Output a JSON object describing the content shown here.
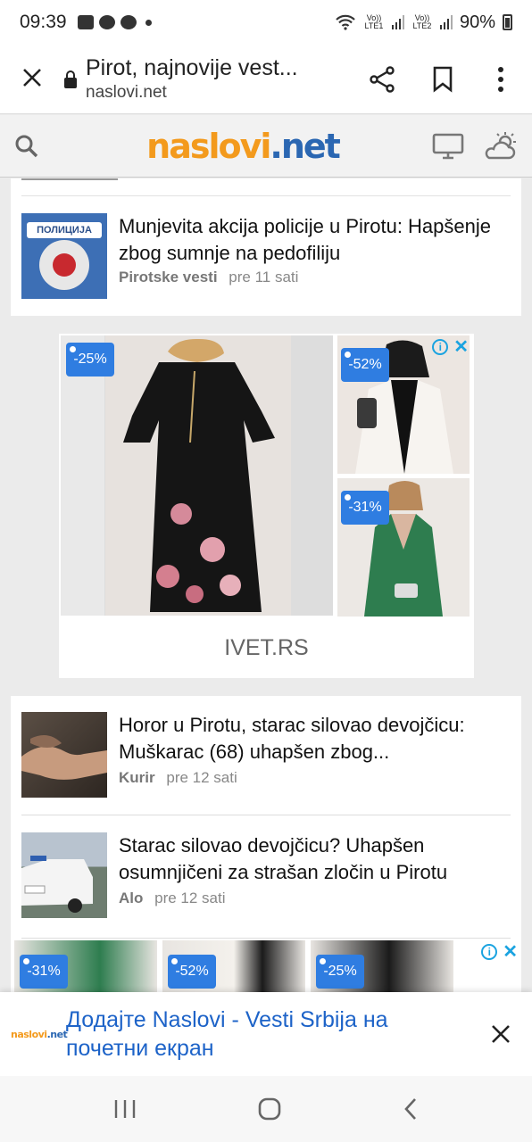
{
  "status_bar": {
    "time": "09:39",
    "lte1": "Vo)) LTE1",
    "lte2": "Vo)) LTE2",
    "battery": "90%"
  },
  "browser": {
    "page_title": "Pirot, najnovije vest...",
    "domain": "naslovi.net"
  },
  "site": {
    "logo_part1": "naslovi",
    "logo_part2": "net"
  },
  "articles": [
    {
      "title": "Munjevita akcija policije u Pirotu: Hapšenje zbog sumnje na pedofiliju",
      "source": "Pirotske vesti",
      "time": "pre 11 sati",
      "badge": "ПОЛИЦИЈА"
    },
    {
      "title": "Horor u Pirotu, starac silovao devojčicu: Muškarac (68) uhapšen zbog...",
      "source": "Kurir",
      "time": "pre 12 sati"
    },
    {
      "title": "Starac silovao devojčicu? Uhapšen osumnjičeni za strašan zločin u Pirotu",
      "source": "Alo",
      "time": "pre 12 sati"
    }
  ],
  "ad": {
    "advertiser": "IVET.RS",
    "discounts": [
      "-25%",
      "-52%",
      "-31%"
    ],
    "strip_discounts": [
      "-31%",
      "-52%",
      "-25%"
    ]
  },
  "home_banner": {
    "logo": "naslovi.net",
    "text": "Додајте Naslovi - Vesti Srbija на почетни екран"
  },
  "colors": {
    "accent_blue": "#2f7de1",
    "logo_orange": "#f39a1d",
    "logo_blue": "#2b67b2",
    "link_blue": "#1d63c8"
  }
}
